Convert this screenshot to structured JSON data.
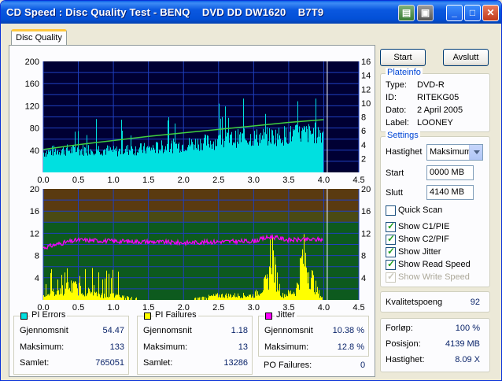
{
  "window": {
    "title": "CD Speed : Disc Quality Test - BENQ    DVD DD DW1620    B7T9",
    "buttons": {
      "min": "_",
      "max": "□",
      "close": "✕"
    }
  },
  "tab": {
    "label": "Disc Quality"
  },
  "actions": {
    "start": "Start",
    "quit": "Avslutt"
  },
  "plateinfo": {
    "title": "Plateinfo",
    "rows": [
      {
        "label": "Type:",
        "value": "DVD-R"
      },
      {
        "label": "ID:",
        "value": "RITEKG05"
      },
      {
        "label": "Dato:",
        "value": "2 April 2005"
      },
      {
        "label": "Label:",
        "value": "LOONEY"
      }
    ]
  },
  "settings": {
    "title": "Settings",
    "speed_label": "Hastighet",
    "speed_value": "Maksimum",
    "start_label": "Start",
    "start_value": "0000 MB",
    "end_label": "Slutt",
    "end_value": "4140 MB",
    "checkboxes": [
      {
        "label": "Quick Scan",
        "checked": false,
        "disabled": false
      },
      {
        "label": "Show C1/PIE",
        "checked": true,
        "disabled": false
      },
      {
        "label": "Show C2/PIF",
        "checked": true,
        "disabled": false
      },
      {
        "label": "Show Jitter",
        "checked": true,
        "disabled": false
      },
      {
        "label": "Show Read Speed",
        "checked": true,
        "disabled": false
      },
      {
        "label": "Show Write Speed",
        "checked": true,
        "disabled": true
      }
    ]
  },
  "quality": {
    "label": "Kvalitetspoeng",
    "value": "92"
  },
  "progress": {
    "rows": [
      {
        "label": "Forløp:",
        "value": "100 %"
      },
      {
        "label": "Posisjon:",
        "value": "4139 MB"
      },
      {
        "label": "Hastighet:",
        "value": "8.09 X"
      }
    ]
  },
  "pi_errors": {
    "title": "PI Errors",
    "color": "#00e0e0",
    "rows": [
      {
        "label": "Gjennomsnit",
        "value": "54.47"
      },
      {
        "label": "Maksimum:",
        "value": "133"
      },
      {
        "label": "Samlet:",
        "value": "765051"
      }
    ]
  },
  "pi_failures": {
    "title": "PI Failures",
    "color": "#ffff00",
    "rows": [
      {
        "label": "Gjennomsnit",
        "value": "1.18"
      },
      {
        "label": "Maksimum:",
        "value": "13"
      },
      {
        "label": "Samlet:",
        "value": "13286"
      }
    ]
  },
  "jitter": {
    "title": "Jitter",
    "color": "#ff00ff",
    "rows": [
      {
        "label": "Gjennomsnit",
        "value": "10.38 %"
      },
      {
        "label": "Maksimum:",
        "value": "12.8 %"
      }
    ],
    "po_label": "PO Failures:",
    "po_value": "0"
  },
  "chart_data": [
    {
      "type": "bar",
      "title": "",
      "xlim": [
        0,
        4.5
      ],
      "ylim_left": [
        0,
        200
      ],
      "ylim_right": [
        0,
        16
      ],
      "x_ticks": [
        "0.0",
        "0.5",
        "1.0",
        "1.5",
        "2.0",
        "2.5",
        "3.0",
        "3.5",
        "4.0",
        "4.5"
      ],
      "y_ticks_left": [
        "200",
        "160",
        "120",
        "80",
        "40"
      ],
      "y_ticks_right": [
        "16",
        "14",
        "12",
        "10",
        "8",
        "6",
        "4",
        "2"
      ],
      "background": "#000033",
      "series": [
        {
          "name": "PI Errors",
          "color": "#00e0e0",
          "x": [
            0.0,
            0.25,
            0.5,
            0.75,
            1.0,
            1.25,
            1.5,
            1.75,
            2.0,
            2.25,
            2.5,
            2.75,
            3.0,
            3.25,
            3.5,
            3.75,
            4.0
          ],
          "values": [
            40,
            45,
            44,
            48,
            42,
            46,
            47,
            52,
            55,
            60,
            62,
            68,
            70,
            72,
            75,
            78,
            80
          ]
        },
        {
          "name": "Read Speed",
          "color": "#40d040",
          "x": [
            0.0,
            0.5,
            1.0,
            1.5,
            2.0,
            2.5,
            3.0,
            3.5,
            4.0
          ],
          "values": [
            3.3,
            4.0,
            4.6,
            5.2,
            5.7,
            6.2,
            6.7,
            7.2,
            7.6
          ]
        }
      ]
    },
    {
      "type": "bar",
      "title": "",
      "xlim": [
        0,
        4.5
      ],
      "ylim": [
        0,
        20
      ],
      "x_ticks": [
        "0.0",
        "0.5",
        "1.0",
        "1.5",
        "2.0",
        "2.5",
        "3.0",
        "3.5",
        "4.0",
        "4.5"
      ],
      "y_ticks": [
        "20",
        "16",
        "12",
        "8",
        "4"
      ],
      "series": [
        {
          "name": "PI Failures",
          "color": "#ffff00",
          "x": [
            0.0,
            0.2,
            0.4,
            0.6,
            0.8,
            1.0,
            1.5,
            2.0,
            2.5,
            3.0,
            3.2,
            3.25,
            3.3,
            3.4,
            3.6,
            3.7,
            3.8,
            3.9,
            4.0
          ],
          "values": [
            1,
            2,
            3,
            2,
            1,
            1,
            0,
            0,
            1,
            1,
            4,
            13,
            6,
            1,
            2,
            10,
            6,
            2,
            0
          ]
        },
        {
          "name": "Jitter",
          "color": "#ff00ff",
          "x": [
            0.0,
            0.25,
            0.5,
            1.0,
            1.5,
            2.0,
            2.5,
            3.0,
            3.25,
            3.5,
            4.0
          ],
          "values": [
            9.4,
            10.2,
            10.8,
            10.6,
            10.5,
            10.3,
            10.5,
            10.6,
            11.4,
            10.8,
            10.9
          ]
        }
      ]
    }
  ]
}
